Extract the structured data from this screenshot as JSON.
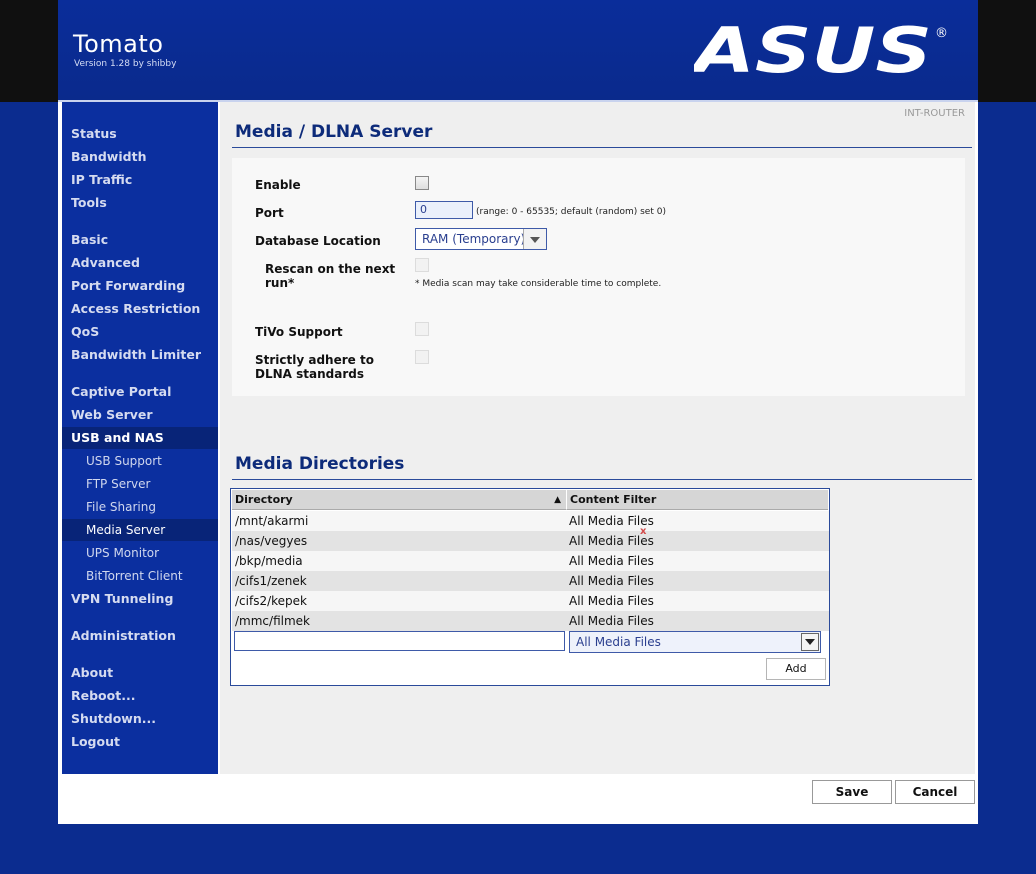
{
  "header": {
    "title": "Tomato",
    "version": "Version 1.28 by shibby",
    "logo": "ASUS",
    "logo_mark": "®"
  },
  "sidebar": {
    "items": [
      {
        "label": "Status"
      },
      {
        "label": "Bandwidth"
      },
      {
        "label": "IP Traffic"
      },
      {
        "label": "Tools"
      },
      {
        "label": "Basic"
      },
      {
        "label": "Advanced"
      },
      {
        "label": "Port Forwarding"
      },
      {
        "label": "Access Restriction"
      },
      {
        "label": "QoS"
      },
      {
        "label": "Bandwidth Limiter"
      },
      {
        "label": "Captive Portal"
      },
      {
        "label": "Web Server"
      },
      {
        "label": "USB and NAS"
      },
      {
        "label": "USB Support"
      },
      {
        "label": "FTP Server"
      },
      {
        "label": "File Sharing"
      },
      {
        "label": "Media Server"
      },
      {
        "label": "UPS Monitor"
      },
      {
        "label": "BitTorrent Client"
      },
      {
        "label": "VPN Tunneling"
      },
      {
        "label": "Administration"
      },
      {
        "label": "About"
      },
      {
        "label": "Reboot..."
      },
      {
        "label": "Shutdown..."
      },
      {
        "label": "Logout"
      }
    ]
  },
  "page": {
    "router_name": "INT-ROUTER",
    "title": "Media / DLNA Server",
    "form": {
      "enable_label": "Enable",
      "port_label": "Port",
      "port_value": "0",
      "port_hint": "(range: 0 - 65535; default (random) set 0)",
      "db_location_label": "Database Location",
      "db_location_value": "RAM (Temporary)",
      "rescan_label_1": "Rescan on the next",
      "rescan_label_2": "run*",
      "rescan_hint": "* Media scan may take considerable time to complete.",
      "tivo_label": "TiVo Support",
      "dlna_label_1": "Strictly adhere to",
      "dlna_label_2": "DLNA standards"
    },
    "directories": {
      "title": "Media Directories",
      "headers": {
        "directory": "Directory",
        "filter": "Content Filter"
      },
      "sort_icon": "▲",
      "rows": [
        {
          "dir": "/mnt/akarmi",
          "filter": "All Media Files"
        },
        {
          "dir": "/nas/vegyes",
          "filter": "All Media Files"
        },
        {
          "dir": "/bkp/media",
          "filter": "All Media Files"
        },
        {
          "dir": "/cifs1/zenek",
          "filter": "All Media Files"
        },
        {
          "dir": "/cifs2/kepek",
          "filter": "All Media Files"
        },
        {
          "dir": "/mmc/filmek",
          "filter": "All Media Files"
        }
      ],
      "new_dir_value": "",
      "new_filter_value": "All Media Files",
      "delete_mark": "x",
      "add_label": "Add"
    },
    "save_label": "Save",
    "cancel_label": "Cancel"
  }
}
